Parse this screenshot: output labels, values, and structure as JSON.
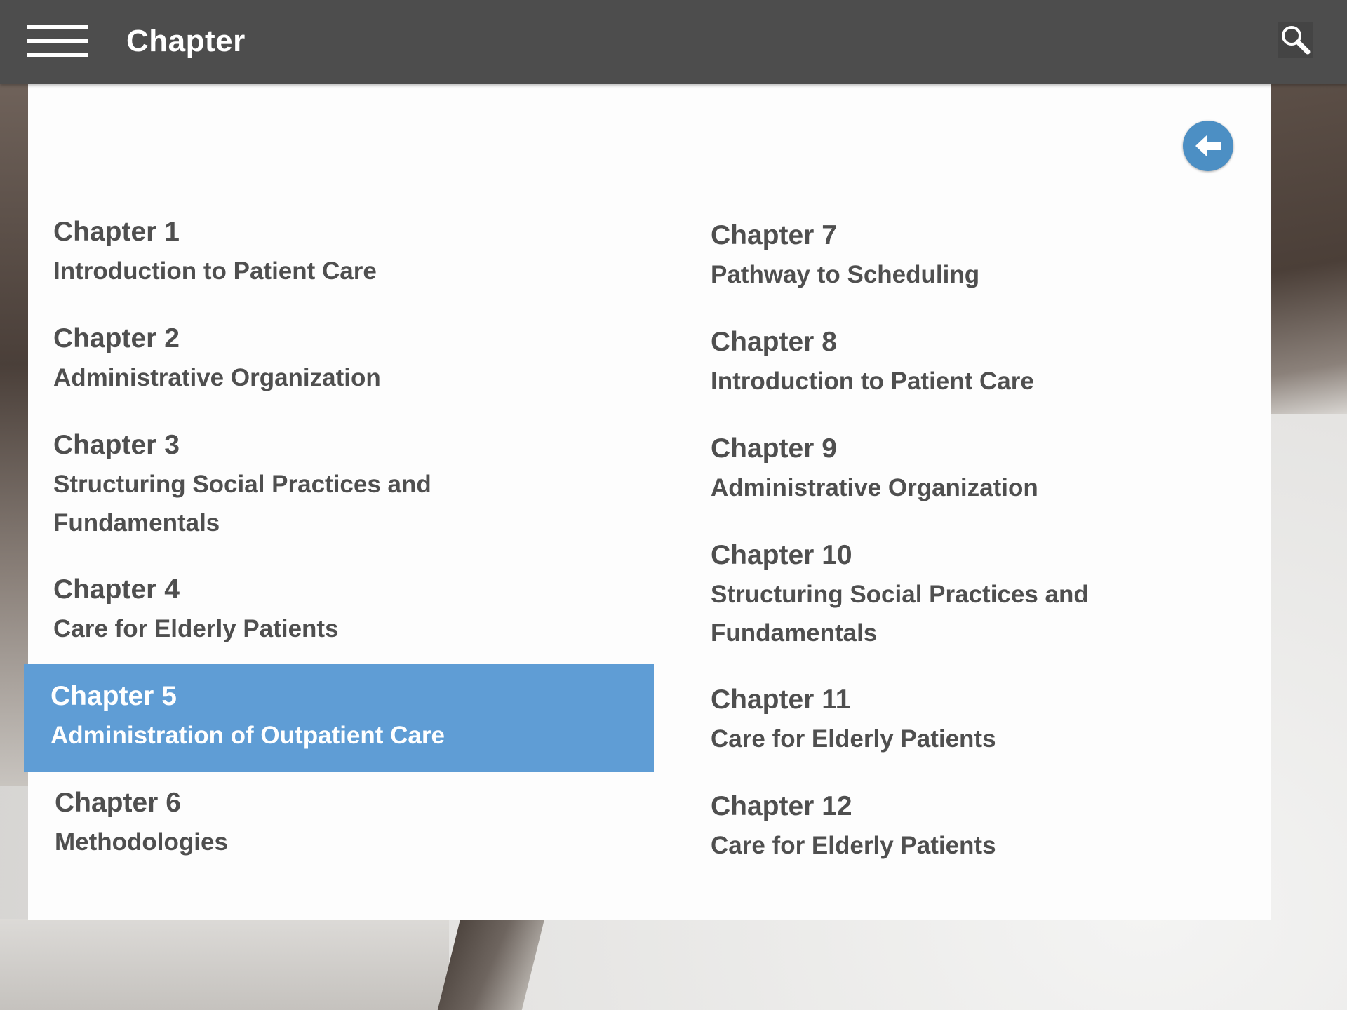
{
  "header": {
    "title": "Chapter"
  },
  "colors": {
    "header_bg": "#4d4d4d",
    "accent": "#4c8fc4",
    "selected_bg": "#5f9dd5",
    "text": "#4f4f4f"
  },
  "icons": {
    "menu": "hamburger-icon",
    "search": "search-icon",
    "back": "arrow-left-icon"
  },
  "chapters_left": [
    {
      "number": "Chapter 1",
      "title": "Introduction to Patient Care"
    },
    {
      "number": "Chapter 2",
      "title": "Administrative Organization"
    },
    {
      "number": "Chapter 3",
      "title": "Structuring Social Practices and Fundamentals"
    },
    {
      "number": "Chapter 4",
      "title": "Care for Elderly Patients"
    },
    {
      "number": "Chapter 5",
      "title": "Administration of Outpatient Care",
      "selected": true
    },
    {
      "number": "Chapter 6",
      "title": "Methodologies"
    }
  ],
  "chapters_right": [
    {
      "number": "Chapter 7",
      "title": "Pathway to Scheduling"
    },
    {
      "number": "Chapter 8",
      "title": "Introduction to Patient Care"
    },
    {
      "number": "Chapter 9",
      "title": "Administrative Organization"
    },
    {
      "number": "Chapter 10",
      "title": "Structuring Social Practices and Fundamentals"
    },
    {
      "number": "Chapter 11",
      "title": "Care for Elderly Patients"
    },
    {
      "number": "Chapter 12",
      "title": "Care for Elderly Patients"
    }
  ]
}
